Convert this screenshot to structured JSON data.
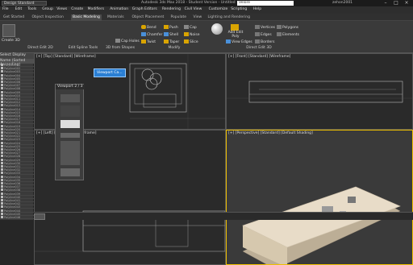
{
  "titlebar": {
    "workspace": "Design Standard",
    "app_title": "Autodesk 3ds Max 2018 - Student Version - Untitled",
    "search_value": "Velore",
    "user": "zehon2001"
  },
  "menubar": {
    "items": [
      "File",
      "Edit",
      "Tools",
      "Group",
      "Views",
      "Create",
      "Modifiers",
      "Animation",
      "Graph Editors",
      "Rendering",
      "Civil View",
      "Customize",
      "Scripting",
      "Help"
    ]
  },
  "ribbon_tabs": {
    "items": [
      "Get Started",
      "Object Inspection",
      "Basic Modeling",
      "Materials",
      "Object Placement",
      "Populate",
      "View",
      "Lighting and Rendering"
    ],
    "active_index": 2
  },
  "ribbon": {
    "create3d": "Create 3D",
    "section_edit2d": "Direct Edit 2D",
    "section_spline": "Edit Spline Tools",
    "section_3dshapes": "3D from Shapes",
    "section_modify": "Modify",
    "section_edit3d": "Direct Edit 3D",
    "btn_cap_holes": "Cap Holes",
    "btn_bend": "Bend",
    "btn_chamfer": "Chamfer",
    "btn_twist": "Twist",
    "btn_push": "Push",
    "btn_shell": "Shell",
    "btn_taper": "Taper",
    "btn_cap": "Cap",
    "btn_noise": "Noise",
    "btn_slice": "Slice",
    "btn_add_edit_poly": "Add Edit Poly",
    "btn_view_edges": "View Edges",
    "btn_vertices": "Vertices",
    "btn_edges": "Edges",
    "btn_borders": "Borders",
    "btn_polygons": "Polygons",
    "btn_elements": "Elements"
  },
  "scene_explorer": {
    "toolbar": "Select  Display",
    "header": "Name (Sorted Ascending)",
    "rows": [
      "Polyline001",
      "Polyline002",
      "Polyline003",
      "Polyline004",
      "Polyline005",
      "Polyline006",
      "Polyline007",
      "Polyline008",
      "Polyline009",
      "Polyline010",
      "Polyline011",
      "Polyline012",
      "Polyline013",
      "Polyline014",
      "Polyline015",
      "Polyline016",
      "Polyline017",
      "Polyline018",
      "Polyline019",
      "Polyline020",
      "Polyline021",
      "Polyline022",
      "Polyline023",
      "Polyline024",
      "Polyline025",
      "Polyline026",
      "Polyline027",
      "Polyline028",
      "Polyline029",
      "Polyline030",
      "Polyline031",
      "Polyline032",
      "Polyline033",
      "Polyline034",
      "Polyline035",
      "Polyline036",
      "Polyline037",
      "Polyline038",
      "Polyline039",
      "Polyline040",
      "Polyline041",
      "Polyline042",
      "Polyline043",
      "Polyline044",
      "Polyline045",
      "Polyline046"
    ]
  },
  "viewports": {
    "top_left": "[+] [Top] [Standard] [Wireframe]",
    "top_right": "[+] [Front] [Standard] [Wireframe]",
    "bottom_left": "[+] [Left] [Standard] [Wireframe]",
    "bottom_right": "[+] [Perspective] [Standard] [Default Shading]",
    "chip_label": "Viewport Ca...",
    "float_label": "Viewport 2 / 3"
  },
  "colors": {
    "accent_blue": "#2a7fd4",
    "viewport_bg": "#2a2a2a",
    "model_top": "#e8dcc8",
    "model_side": "#bcae96"
  }
}
